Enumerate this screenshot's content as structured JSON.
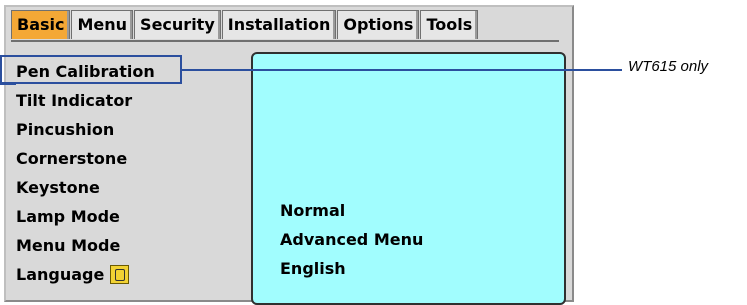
{
  "tabs": [
    {
      "label": "Basic",
      "active": true
    },
    {
      "label": "Menu",
      "active": false
    },
    {
      "label": "Security",
      "active": false
    },
    {
      "label": "Installation",
      "active": false
    },
    {
      "label": "Options",
      "active": false
    },
    {
      "label": "Tools",
      "active": false
    }
  ],
  "menu_items": [
    {
      "label": "Pen Calibration"
    },
    {
      "label": "Tilt Indicator"
    },
    {
      "label": "Pincushion"
    },
    {
      "label": "Cornerstone"
    },
    {
      "label": "Keystone"
    },
    {
      "label": "Lamp Mode"
    },
    {
      "label": "Menu Mode"
    },
    {
      "label": "Language"
    }
  ],
  "values": {
    "lamp_mode": "Normal",
    "menu_mode": "Advanced Menu",
    "language": "English"
  },
  "callout": {
    "label": "WT615 only"
  },
  "colors": {
    "active_tab": "#f4a836",
    "panel": "#a1fdfe",
    "callout": "#2b4f9e",
    "menu_bg": "#d9d9d9"
  },
  "icons": {
    "language": "language-globe-icon"
  }
}
